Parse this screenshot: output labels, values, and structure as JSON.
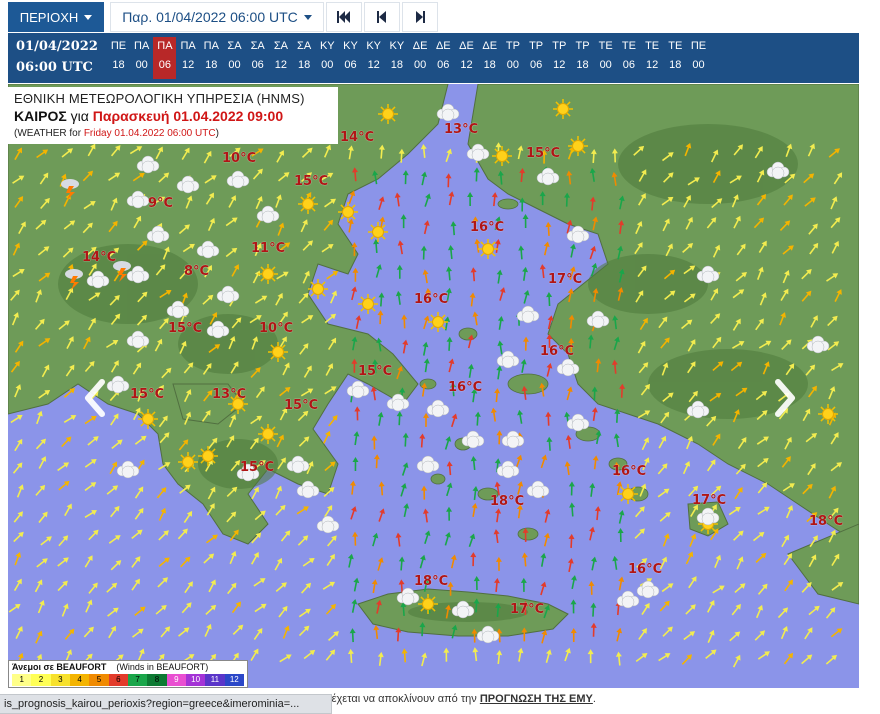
{
  "toolbar": {
    "region_label": "ΠΕΡΙΟΧΗ",
    "date_label": "Παρ. 01/04/2022 06:00 UTC",
    "nav_first": "first-frame-icon",
    "nav_prev": "step-back-icon",
    "nav_next": "step-forward-icon"
  },
  "strip": {
    "current_date": "01/04/2022",
    "current_time": "06:00 UTC",
    "slots": [
      {
        "day": "ΠΕ",
        "hour": "18"
      },
      {
        "day": "ΠΑ",
        "hour": "00"
      },
      {
        "day": "ΠΑ",
        "hour": "06",
        "active": true
      },
      {
        "day": "ΠΑ",
        "hour": "12"
      },
      {
        "day": "ΠΑ",
        "hour": "18"
      },
      {
        "day": "ΣΑ",
        "hour": "00"
      },
      {
        "day": "ΣΑ",
        "hour": "06"
      },
      {
        "day": "ΣΑ",
        "hour": "12"
      },
      {
        "day": "ΣΑ",
        "hour": "18"
      },
      {
        "day": "ΚΥ",
        "hour": "00"
      },
      {
        "day": "ΚΥ",
        "hour": "06"
      },
      {
        "day": "ΚΥ",
        "hour": "12"
      },
      {
        "day": "ΚΥ",
        "hour": "18"
      },
      {
        "day": "ΔΕ",
        "hour": "00"
      },
      {
        "day": "ΔΕ",
        "hour": "06"
      },
      {
        "day": "ΔΕ",
        "hour": "12"
      },
      {
        "day": "ΔΕ",
        "hour": "18"
      },
      {
        "day": "ΤΡ",
        "hour": "00"
      },
      {
        "day": "ΤΡ",
        "hour": "06"
      },
      {
        "day": "ΤΡ",
        "hour": "12"
      },
      {
        "day": "ΤΡ",
        "hour": "18"
      },
      {
        "day": "ΤΕ",
        "hour": "00"
      },
      {
        "day": "ΤΕ",
        "hour": "06"
      },
      {
        "day": "ΤΕ",
        "hour": "12"
      },
      {
        "day": "ΤΕ",
        "hour": "18"
      },
      {
        "day": "ΠΕ",
        "hour": "00"
      }
    ]
  },
  "title": {
    "line1": "ΕΘΝΙΚΗ ΜΕΤΕΩΡΟΛΟΓΙΚΗ ΥΠΗΡΕΣΙΑ (HNMS)",
    "line2_prefix": "ΚΑΙΡΟΣ",
    "line2_mid": " για ",
    "line2_date": "Παρασκευή 01.04.2022 09:00",
    "line3_prefix": "(WEATHER for ",
    "line3_date": "Friday 01.04.2022 06:00 UTC",
    "line3_suffix": ")"
  },
  "temperatures": [
    {
      "label": "14°C"
    },
    {
      "label": "13°C"
    },
    {
      "label": "10°C"
    },
    {
      "label": "15°C"
    },
    {
      "label": "15°C"
    },
    {
      "label": "9°C"
    },
    {
      "label": "16°C"
    },
    {
      "label": "11°C"
    },
    {
      "label": "14°C"
    },
    {
      "label": "8°C"
    },
    {
      "label": "17°C"
    },
    {
      "label": "16°C"
    },
    {
      "label": "15°C"
    },
    {
      "label": "10°C"
    },
    {
      "label": "16°C"
    },
    {
      "label": "15°C"
    },
    {
      "label": "16°C"
    },
    {
      "label": "15°C"
    },
    {
      "label": "13°C"
    },
    {
      "label": "15°C"
    },
    {
      "label": "15°C"
    },
    {
      "label": "16°C"
    },
    {
      "label": "18°C"
    },
    {
      "label": "17°C"
    },
    {
      "label": "18°C"
    },
    {
      "label": "16°C"
    },
    {
      "label": "18°C"
    },
    {
      "label": "17°C"
    }
  ],
  "legend": {
    "title": "Άνεμοι σε BEAUFORT",
    "subtitle": "(Winds in BEAUFORT)",
    "levels": [
      {
        "n": "1",
        "color": "#ffff88"
      },
      {
        "n": "2",
        "color": "#ffff55"
      },
      {
        "n": "3",
        "color": "#f7e12c"
      },
      {
        "n": "4",
        "color": "#f4b400"
      },
      {
        "n": "5",
        "color": "#f08a00"
      },
      {
        "n": "6",
        "color": "#e33b2b"
      },
      {
        "n": "7",
        "color": "#1aa64a"
      },
      {
        "n": "8",
        "color": "#0d7a33"
      },
      {
        "n": "9",
        "color": "#e94fd1"
      },
      {
        "n": "10",
        "color": "#a433d6"
      },
      {
        "n": "11",
        "color": "#5a35c9"
      },
      {
        "n": "12",
        "color": "#2b47c8"
      }
    ]
  },
  "footnote": {
    "text": "νδέχεται να αποκλίνουν από την ",
    "link": "ΠΡΟΓΝΩΣΗ ΤΗΣ ΕΜΥ",
    "end": "."
  },
  "status_url": "is_prognosis_kairou_perioxis?region=greece&imerominia=...",
  "colors": {
    "brand": "#1d4f85",
    "active": "#b82828",
    "sea": "#8b94e9",
    "land": "#6b9a55",
    "temp": "#b01515"
  }
}
